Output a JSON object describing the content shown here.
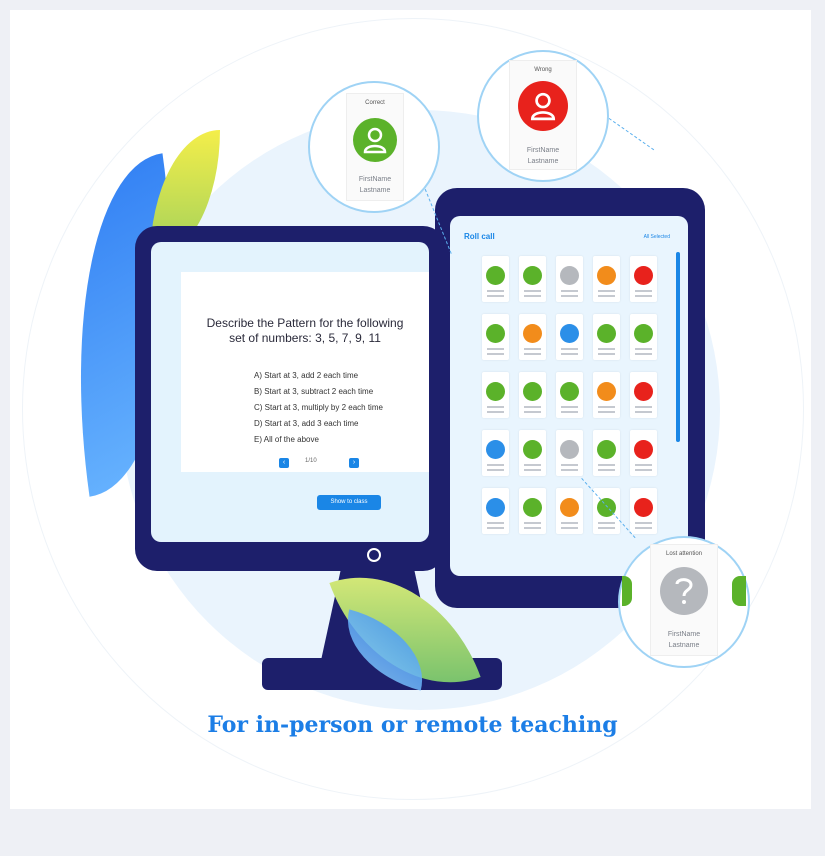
{
  "question": {
    "line1": "Describe the Pattern for the following",
    "line2": "set of numbers: 3, 5, 7, 9, 11"
  },
  "options": [
    "A) Start at 3, add 2 each time",
    "B) Start at 3, subtract 2 each time",
    "C) Start at 3, multiply by 2 each time",
    "D) Start at 3, add 3 each time",
    "E) All of the above"
  ],
  "pager": {
    "page": "1/10",
    "prev": "‹",
    "next": "›"
  },
  "show_button": "Show to class",
  "roll": {
    "title": "Roll call",
    "link": "All Selected"
  },
  "bubbles": {
    "correct": {
      "status": "Correct",
      "first": "FirstName",
      "last": "Lastname"
    },
    "wrong": {
      "status": "Wrong",
      "first": "FirstName",
      "last": "Lastname"
    },
    "lost": {
      "status": "Lost attention",
      "first": "FirstName",
      "last": "Lastname"
    }
  },
  "tagline": "For in-person or remote teaching",
  "colors": {
    "green": "#5bb22a",
    "orange": "#f28c1b",
    "red": "#e8221c",
    "blue": "#2b8fe8",
    "gray": "#b5b8bd",
    "brand": "#1c7ee6",
    "navy": "#1d1f6b"
  },
  "grid": [
    [
      "green",
      "green",
      "gray",
      "orange",
      "red"
    ],
    [
      "green",
      "orange",
      "blue",
      "green",
      "green"
    ],
    [
      "green",
      "green",
      "green",
      "orange",
      "red"
    ],
    [
      "blue",
      "green",
      "gray",
      "green",
      "red"
    ],
    [
      "blue",
      "green",
      "orange",
      "green",
      "red"
    ]
  ]
}
